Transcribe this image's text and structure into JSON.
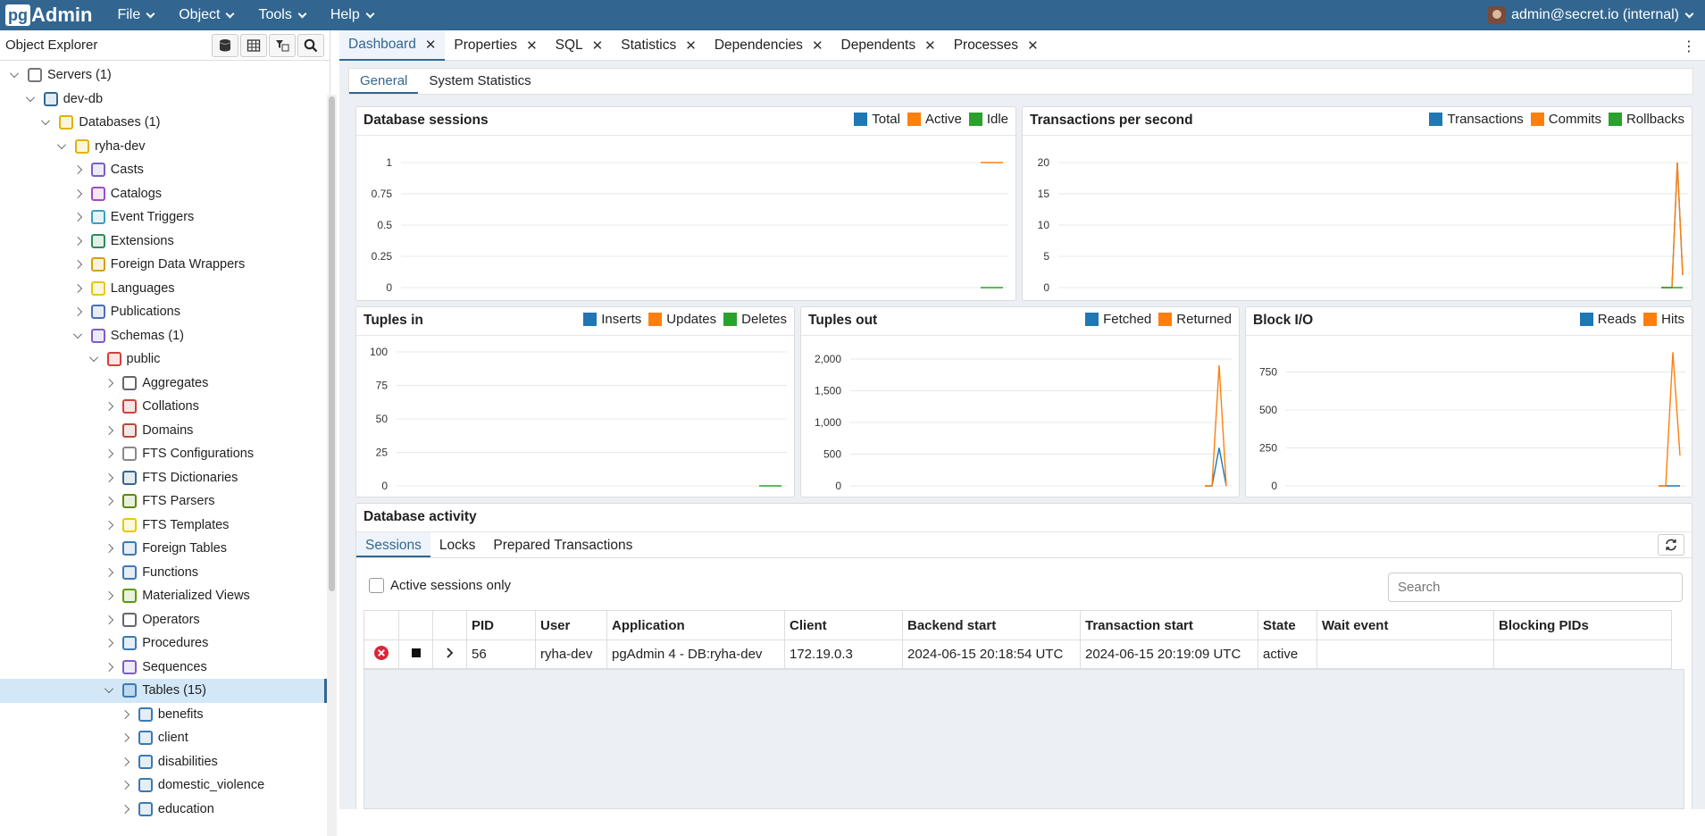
{
  "app": {
    "logo_pg": "pg",
    "logo_admin": "Admin",
    "user": "admin@secret.io (internal)"
  },
  "menu": [
    "File",
    "Object",
    "Tools",
    "Help"
  ],
  "explorer": {
    "title": "Object Explorer",
    "tree": [
      {
        "label": "Servers (1)",
        "level": 0,
        "state": "down",
        "icon": "servers-icon",
        "color": "#777"
      },
      {
        "label": "dev-db",
        "level": 1,
        "state": "down",
        "icon": "elephant-icon",
        "color": "#336791"
      },
      {
        "label": "Databases (1)",
        "level": 2,
        "state": "down",
        "icon": "databases-icon",
        "color": "#e2b200"
      },
      {
        "label": "ryha-dev",
        "level": 3,
        "state": "down",
        "icon": "database-icon",
        "color": "#e2b200"
      },
      {
        "label": "Casts",
        "level": 4,
        "state": "right",
        "icon": "casts-icon",
        "color": "#7b5ec6"
      },
      {
        "label": "Catalogs",
        "level": 4,
        "state": "right",
        "icon": "catalogs-icon",
        "color": "#9b4fc6"
      },
      {
        "label": "Event Triggers",
        "level": 4,
        "state": "right",
        "icon": "event-triggers-icon",
        "color": "#3aa0c0"
      },
      {
        "label": "Extensions",
        "level": 4,
        "state": "right",
        "icon": "extensions-icon",
        "color": "#2e8b57"
      },
      {
        "label": "Foreign Data Wrappers",
        "level": 4,
        "state": "right",
        "icon": "foreign-data-wrappers-icon",
        "color": "#d6a100"
      },
      {
        "label": "Languages",
        "level": 4,
        "state": "right",
        "icon": "languages-icon",
        "color": "#e6c800"
      },
      {
        "label": "Publications",
        "level": 4,
        "state": "right",
        "icon": "publications-icon",
        "color": "#4a6fb5"
      },
      {
        "label": "Schemas (1)",
        "level": 4,
        "state": "down",
        "icon": "schemas-icon",
        "color": "#7b5ec6"
      },
      {
        "label": "public",
        "level": 5,
        "state": "down",
        "icon": "schema-icon",
        "color": "#d43f3a"
      },
      {
        "label": "Aggregates",
        "level": 6,
        "state": "right",
        "icon": "aggregates-icon",
        "color": "#666"
      },
      {
        "label": "Collations",
        "level": 6,
        "state": "right",
        "icon": "collations-icon",
        "color": "#d43f3a"
      },
      {
        "label": "Domains",
        "level": 6,
        "state": "right",
        "icon": "domains-icon",
        "color": "#b04a3a"
      },
      {
        "label": "FTS Configurations",
        "level": 6,
        "state": "right",
        "icon": "fts-configurations-icon",
        "color": "#888"
      },
      {
        "label": "FTS Dictionaries",
        "level": 6,
        "state": "right",
        "icon": "fts-dictionaries-icon",
        "color": "#336791"
      },
      {
        "label": "FTS Parsers",
        "level": 6,
        "state": "right",
        "icon": "fts-parsers-icon",
        "color": "#5a8a00"
      },
      {
        "label": "FTS Templates",
        "level": 6,
        "state": "right",
        "icon": "fts-templates-icon",
        "color": "#e6c800"
      },
      {
        "label": "Foreign Tables",
        "level": 6,
        "state": "right",
        "icon": "foreign-tables-icon",
        "color": "#3a7ab5"
      },
      {
        "label": "Functions",
        "level": 6,
        "state": "right",
        "icon": "functions-icon",
        "color": "#3a7ab5"
      },
      {
        "label": "Materialized Views",
        "level": 6,
        "state": "right",
        "icon": "materialized-views-icon",
        "color": "#5a9a00"
      },
      {
        "label": "Operators",
        "level": 6,
        "state": "right",
        "icon": "operators-icon",
        "color": "#666"
      },
      {
        "label": "Procedures",
        "level": 6,
        "state": "right",
        "icon": "procedures-icon",
        "color": "#3a7ab5"
      },
      {
        "label": "Sequences",
        "level": 6,
        "state": "right",
        "icon": "sequences-icon",
        "color": "#7b5ec6"
      },
      {
        "label": "Tables (15)",
        "level": 6,
        "state": "down",
        "icon": "tables-icon",
        "color": "#3a7ab5",
        "selected": true
      },
      {
        "label": "benefits",
        "level": 7,
        "state": "right",
        "icon": "table-icon",
        "color": "#3a7ab5"
      },
      {
        "label": "client",
        "level": 7,
        "state": "right",
        "icon": "table-icon",
        "color": "#3a7ab5"
      },
      {
        "label": "disabilities",
        "level": 7,
        "state": "right",
        "icon": "table-icon",
        "color": "#3a7ab5"
      },
      {
        "label": "domestic_violence",
        "level": 7,
        "state": "right",
        "icon": "table-icon",
        "color": "#3a7ab5"
      },
      {
        "label": "education",
        "level": 7,
        "state": "right",
        "icon": "table-icon",
        "color": "#3a7ab5"
      }
    ]
  },
  "tabs": [
    "Dashboard",
    "Properties",
    "SQL",
    "Statistics",
    "Dependencies",
    "Dependents",
    "Processes"
  ],
  "subtabs": [
    "General",
    "System Statistics"
  ],
  "colors": {
    "blue": "#1f77b4",
    "orange": "#ff7f0e",
    "green": "#2ca02c"
  },
  "panels": {
    "sessions": {
      "title": "Database sessions",
      "legend": [
        "Total",
        "Active",
        "Idle"
      ]
    },
    "tps": {
      "title": "Transactions per second",
      "legend": [
        "Transactions",
        "Commits",
        "Rollbacks"
      ]
    },
    "tuples_in": {
      "title": "Tuples in",
      "legend": [
        "Inserts",
        "Updates",
        "Deletes"
      ]
    },
    "tuples_out": {
      "title": "Tuples out",
      "legend": [
        "Fetched",
        "Returned"
      ]
    },
    "block_io": {
      "title": "Block I/O",
      "legend": [
        "Reads",
        "Hits"
      ]
    }
  },
  "chart_data": [
    {
      "type": "line",
      "title": "Database sessions",
      "ylim": [
        0,
        1
      ],
      "yticks": [
        "0",
        "0.25",
        "0.5",
        "0.75",
        "1"
      ],
      "series": [
        {
          "name": "Active",
          "values": [
            1,
            1
          ]
        },
        {
          "name": "Idle",
          "values": [
            0,
            0
          ]
        }
      ]
    },
    {
      "type": "line",
      "title": "Transactions per second",
      "ylim": [
        0,
        20
      ],
      "yticks": [
        "0",
        "5",
        "10",
        "15",
        "20"
      ],
      "series": [
        {
          "name": "Transactions",
          "values": [
            0,
            0,
            0,
            20,
            2
          ]
        },
        {
          "name": "Commits",
          "values": [
            0,
            0,
            0,
            20,
            2
          ]
        },
        {
          "name": "Rollbacks",
          "values": [
            0,
            0,
            0,
            0,
            0
          ]
        }
      ]
    },
    {
      "type": "line",
      "title": "Tuples in",
      "ylim": [
        0,
        100
      ],
      "yticks": [
        "0",
        "25",
        "50",
        "75",
        "100"
      ],
      "series": [
        {
          "name": "Deletes",
          "values": [
            0,
            0
          ]
        }
      ]
    },
    {
      "type": "line",
      "title": "Tuples out",
      "ylim": [
        0,
        2000
      ],
      "yticks": [
        "0",
        "500",
        "1,000",
        "1,500",
        "2,000"
      ],
      "series": [
        {
          "name": "Fetched",
          "values": [
            0,
            0,
            600,
            0
          ]
        },
        {
          "name": "Returned",
          "values": [
            0,
            0,
            1900,
            0
          ]
        }
      ]
    },
    {
      "type": "line",
      "title": "Block I/O",
      "ylim": [
        0,
        1000
      ],
      "yticks": [
        "0",
        "250",
        "500",
        "750"
      ],
      "series": [
        {
          "name": "Reads",
          "values": [
            0,
            0,
            0,
            0
          ]
        },
        {
          "name": "Hits",
          "values": [
            0,
            0,
            880,
            200
          ]
        }
      ]
    }
  ],
  "activity": {
    "title": "Database activity",
    "tabs": [
      "Sessions",
      "Locks",
      "Prepared Transactions"
    ],
    "active_only_label": "Active sessions only",
    "search_placeholder": "Search",
    "columns": [
      "",
      "",
      "",
      "PID",
      "User",
      "Application",
      "Client",
      "Backend start",
      "Transaction start",
      "State",
      "Wait event",
      "Blocking PIDs"
    ],
    "rows": [
      {
        "pid": "56",
        "user": "ryha-dev",
        "application": "pgAdmin 4 - DB:ryha-dev",
        "client": "172.19.0.3",
        "backend_start": "2024-06-15 20:18:54 UTC",
        "transaction_start": "2024-06-15 20:19:09 UTC",
        "state": "active",
        "wait_event": "",
        "blocking_pids": ""
      }
    ]
  }
}
